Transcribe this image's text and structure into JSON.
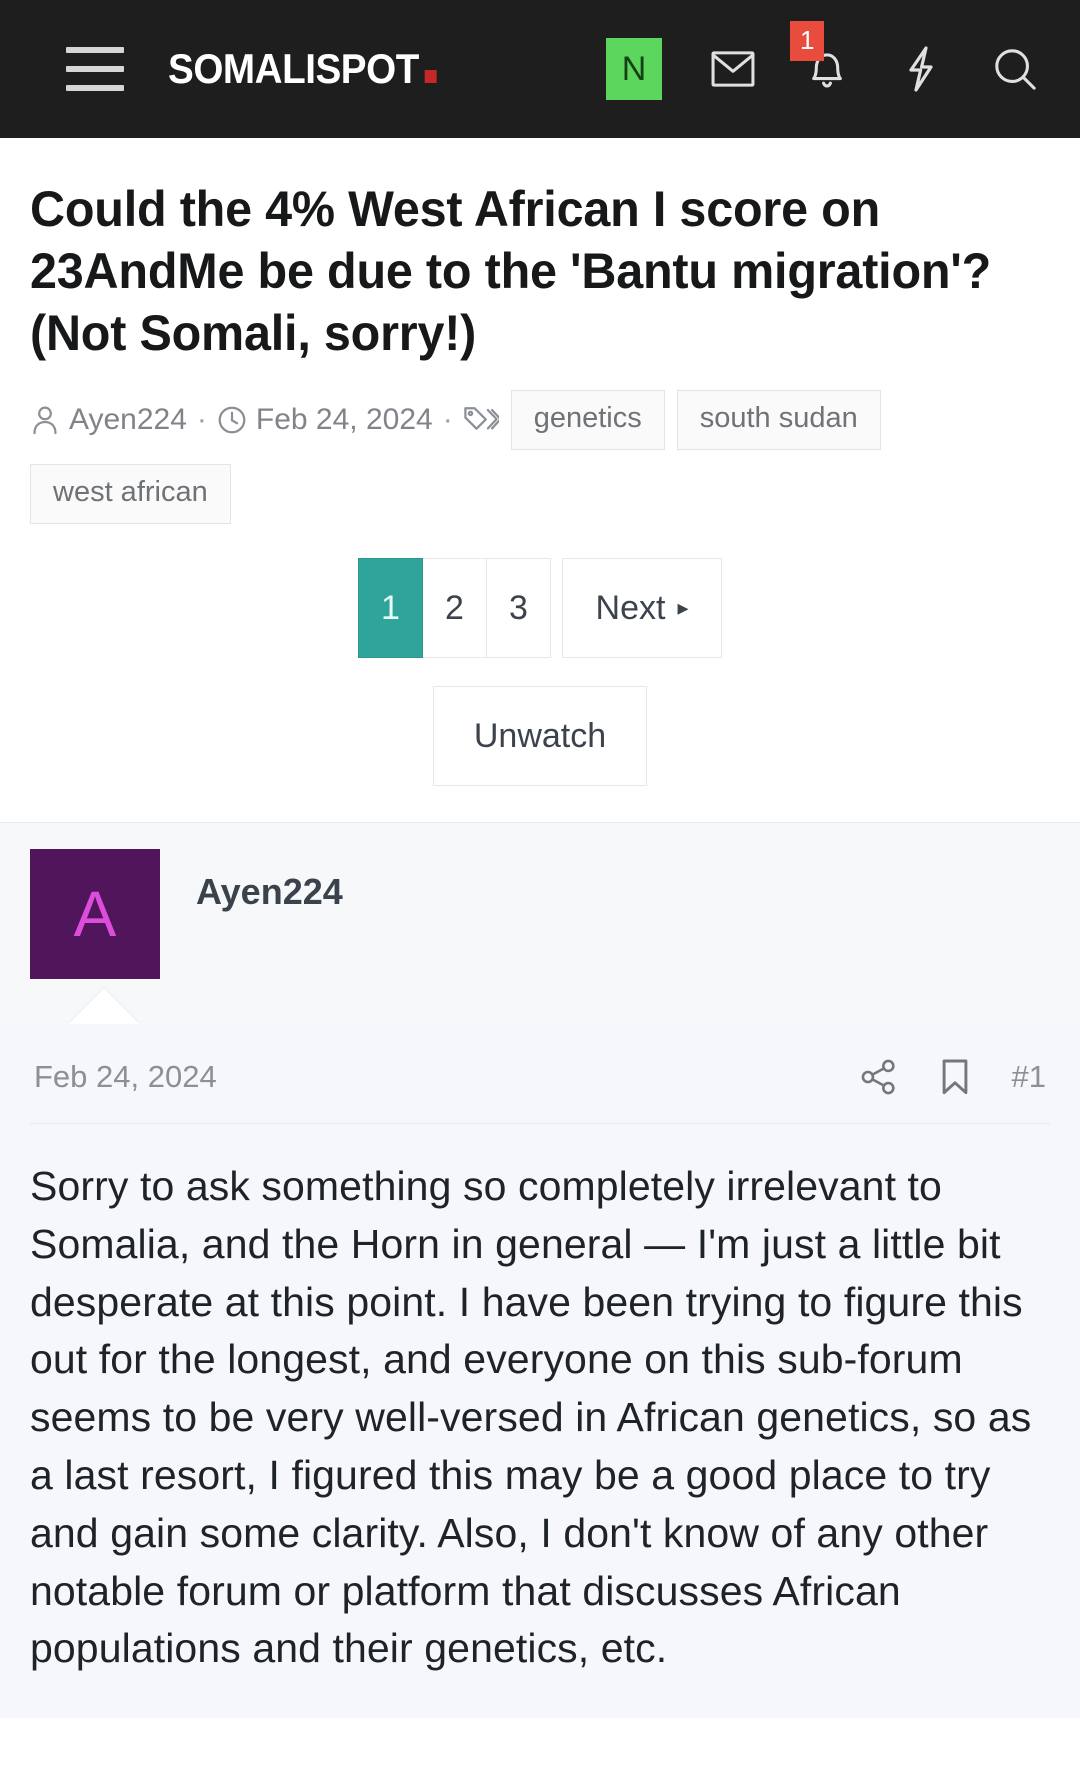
{
  "navbar": {
    "menu_icon": "hamburger-icon",
    "brand": "SOMALISPOT",
    "brand_dot_color": "#c62828",
    "new_badge": "N",
    "new_badge_color": "#5cd65c",
    "inbox_icon": "envelope-icon",
    "alerts_icon": "bell-icon",
    "alerts_count": "1",
    "alerts_count_color": "#e74c3c",
    "bolt_icon": "lightning-bolt-icon",
    "search_icon": "search-icon",
    "background": "#1e1e1e"
  },
  "thread": {
    "title": "Could the 4% West African I score on 23AndMe be due to the 'Bantu migration'? (Not Somali, sorry!)",
    "author_icon": "user-icon",
    "author": "Ayen224",
    "date_icon": "clock-icon",
    "date": "Feb 24, 2024",
    "tag_icon": "tags-icon",
    "separator": "·",
    "tags": [
      "genetics",
      "south sudan",
      "west african"
    ]
  },
  "pagination": {
    "pages": [
      "1",
      "2",
      "3"
    ],
    "active_page": "1",
    "active_color": "#2ea49a",
    "next_label": "Next",
    "next_arrow": "▸"
  },
  "watch": {
    "label": "Unwatch"
  },
  "post": {
    "avatar_letter": "A",
    "avatar_bg": "#50155a",
    "avatar_fg": "#dc4ddc",
    "username": "Ayen224",
    "date": "Feb 24, 2024",
    "share_icon": "share-icon",
    "bookmark_icon": "bookmark-icon",
    "post_number": "#1",
    "text": "Sorry to ask something so completely irrelevant to Somalia, and the Horn in general — I'm just a little bit desperate at this point. I have been trying to figure this out for the longest, and everyone on this sub-forum seems to be very well-versed in African genetics, so as a last resort, I figured this may be a good place to try and gain some clarity. Also, I don't know of any other notable forum or platform that discusses African populations and their genetics, etc."
  }
}
